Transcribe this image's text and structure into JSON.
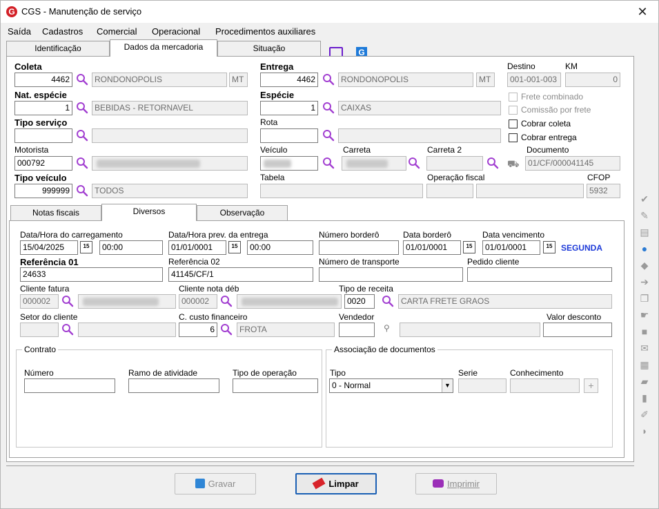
{
  "window": {
    "title": "CGS - Manutenção de serviço",
    "app_icon": "G"
  },
  "menu": {
    "items": [
      "Saída",
      "Cadastros",
      "Comercial",
      "Operacional",
      "Procedimentos auxiliares"
    ]
  },
  "top_tabs": [
    "Identificação",
    "Dados da mercadoria",
    "Situação"
  ],
  "mercadoria": {
    "coleta_label": "Coleta",
    "coleta_code": "4462",
    "coleta_city": "RONDONOPOLIS",
    "coleta_uf": "MT",
    "entrega_label": "Entrega",
    "entrega_code": "4462",
    "entrega_city": "RONDONOPOLIS",
    "entrega_uf": "MT",
    "destino_label": "Destino",
    "destino_value": "001-001-003",
    "km_label": "KM",
    "km_value": "0",
    "nat_label": "Nat. espécie",
    "nat_code": "1",
    "nat_desc": "BEBIDAS - RETORNAVEL",
    "especie_label": "Espécie",
    "especie_code": "1",
    "especie_desc": "CAIXAS",
    "frete_combinado": "Frete combinado",
    "comissao_frete": "Comissão por frete",
    "cobrar_coleta": "Cobrar coleta",
    "cobrar_entrega": "Cobrar entrega",
    "tipo_servico_label": "Tipo serviço",
    "rota_label": "Rota",
    "motorista_label": "Motorista",
    "motorista_code": "000792",
    "veiculo_label": "Veículo",
    "carreta_label": "Carreta",
    "carreta2_label": "Carreta 2",
    "documento_label": "Documento",
    "documento_value": "01/CF/000041145",
    "tipo_veiculo_label": "Tipo veículo",
    "tipo_veiculo_code": "999999",
    "tipo_veiculo_desc": "TODOS",
    "tabela_label": "Tabela",
    "operacao_fiscal_label": "Operação fiscal",
    "cfop_label": "CFOP",
    "cfop_value": "5932"
  },
  "sub_tabs": [
    "Notas fiscais",
    "Diversos",
    "Observação"
  ],
  "diversos": {
    "carregamento_label": "Data/Hora do carregamento",
    "carregamento_date": "15/04/2025",
    "carregamento_time": "00:00",
    "prev_entrega_label": "Data/Hora prev. da entrega",
    "prev_entrega_date": "01/01/0001",
    "prev_entrega_time": "00:00",
    "bordero_num_label": "Número borderô",
    "bordero_date_label": "Data borderô",
    "bordero_date": "01/01/0001",
    "vencimento_label": "Data vencimento",
    "vencimento_date": "01/01/0001",
    "weekday": "SEGUNDA",
    "ref1_label": "Referência 01",
    "ref1_value": "24633",
    "ref2_label": "Referência 02",
    "ref2_value": "41145/CF/1",
    "num_transporte_label": "Número de transporte",
    "pedido_cliente_label": "Pedido cliente",
    "cliente_fatura_label": "Cliente fatura",
    "cliente_fatura_code": "000002",
    "cliente_nota_label": "Cliente nota déb",
    "cliente_nota_code": "000002",
    "tipo_receita_label": "Tipo de receita",
    "tipo_receita_code": "0020",
    "tipo_receita_desc": "CARTA FRETE GRAOS",
    "setor_label": "Setor do cliente",
    "custo_label": "C. custo financeiro",
    "custo_code": "6",
    "custo_desc": "FROTA",
    "vendedor_label": "Vendedor",
    "valor_desconto_label": "Valor desconto",
    "contrato_label": "Contrato",
    "numero_label": "Número",
    "ramo_label": "Ramo de atividade",
    "tipo_operacao_label": "Tipo de operação",
    "assoc_label": "Associação de documentos",
    "tipo_label": "Tipo",
    "tipo_value": "0 - Normal",
    "serie_label": "Serie",
    "conhecimento_label": "Conhecimento"
  },
  "buttons": {
    "gravar": "Gravar",
    "limpar": "Limpar",
    "imprimir": "Imprimir"
  },
  "side_icons": [
    "check-icon",
    "stamp-icon",
    "ciot-icon",
    "globe-icon",
    "tag-icon",
    "forward-icon",
    "copy-icon",
    "hand-icon",
    "truck-icon",
    "money-icon",
    "document-icon",
    "eraser-icon",
    "book-icon",
    "signature-icon",
    "shield-icon"
  ]
}
